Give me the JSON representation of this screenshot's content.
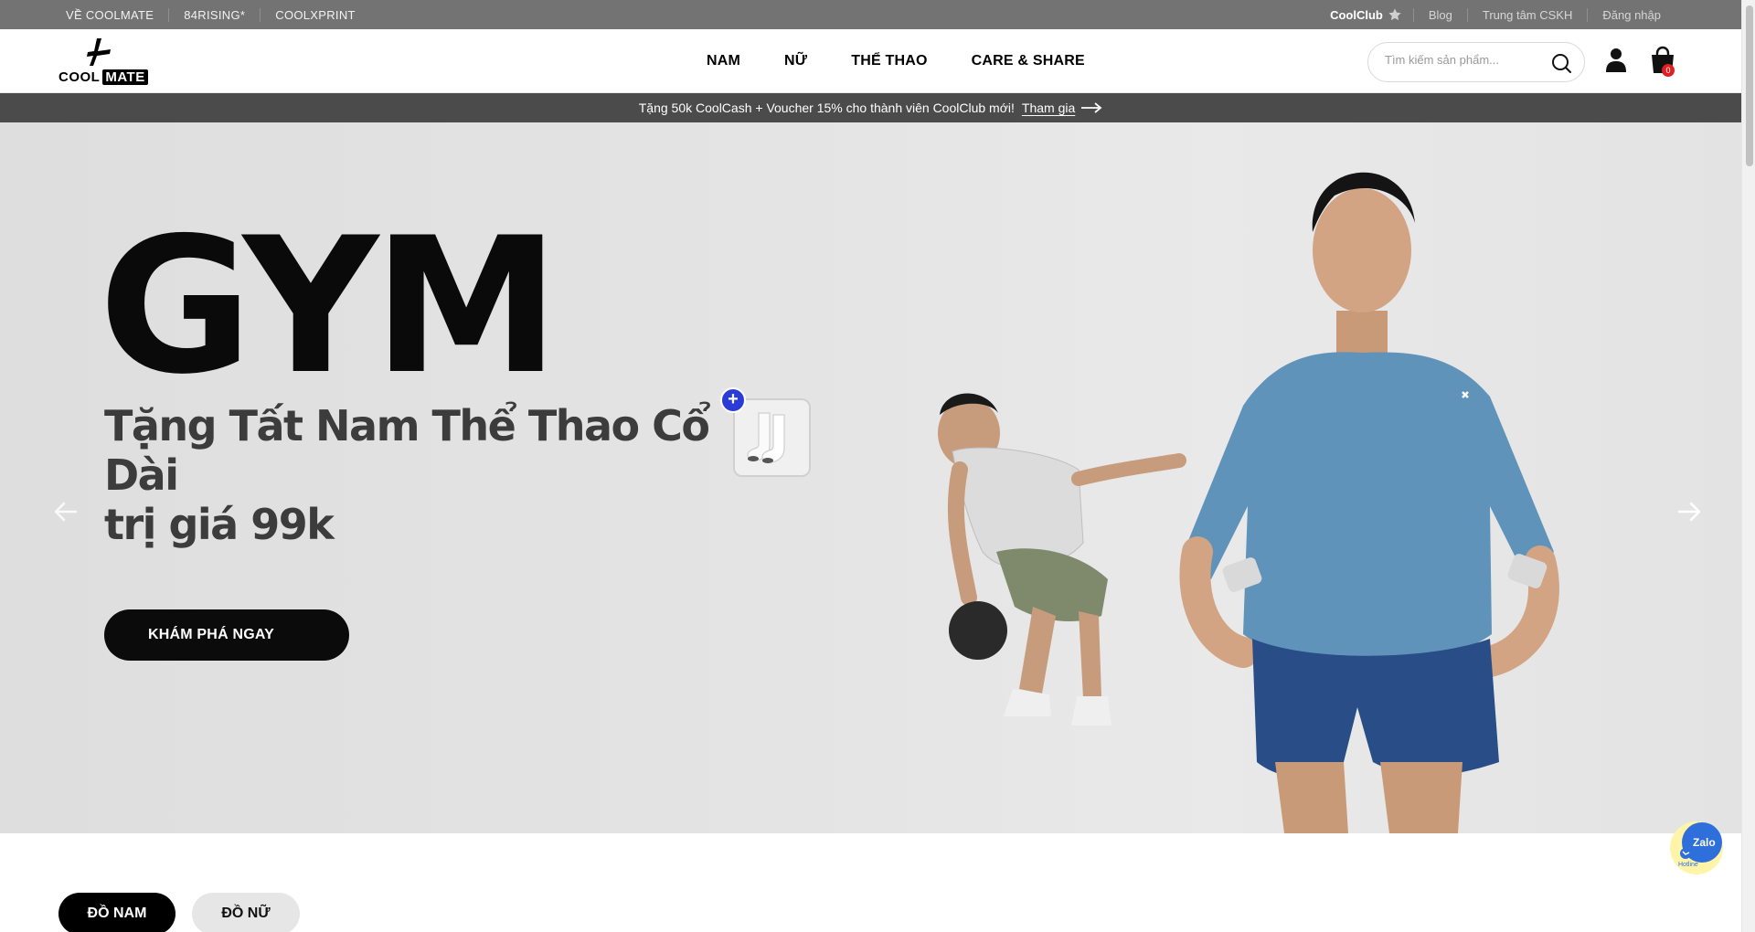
{
  "topbar": {
    "left_links": [
      "VỀ COOLMATE",
      "84RISING*",
      "COOLXPRINT"
    ],
    "club_label": "CoolClub",
    "right_links": [
      "Blog",
      "Trung tâm CSKH",
      "Đăng nhập"
    ]
  },
  "header": {
    "logo_top": "COOL",
    "logo_box": "MATE",
    "nav": [
      "NAM",
      "NỮ",
      "THỂ THAO",
      "CARE & SHARE"
    ],
    "search_placeholder": "Tìm kiếm sản phẩm...",
    "cart_count": "0"
  },
  "promo": {
    "text": "Tặng 50k CoolCash + Voucher 15% cho thành viên CoolClub mới!",
    "link": "Tham gia"
  },
  "hero": {
    "title": "GYM",
    "subtitle_line1": "Tặng Tất Nam Thể Thao Cổ Dài",
    "subtitle_line2": "trị giá 99k",
    "cta": "KHÁM PHÁ NGAY"
  },
  "widgets": {
    "zalo_label": "Zalo",
    "hotline_label": "Hotline"
  },
  "category_tabs": [
    "ĐỒ NAM",
    "ĐỒ NỮ"
  ],
  "colors": {
    "topbar_bg": "#737373",
    "promo_bg": "#4b4b4b",
    "cta_bg": "#0b0b0b",
    "plus_accent": "#2a3bd6",
    "badge": "#e02020"
  }
}
